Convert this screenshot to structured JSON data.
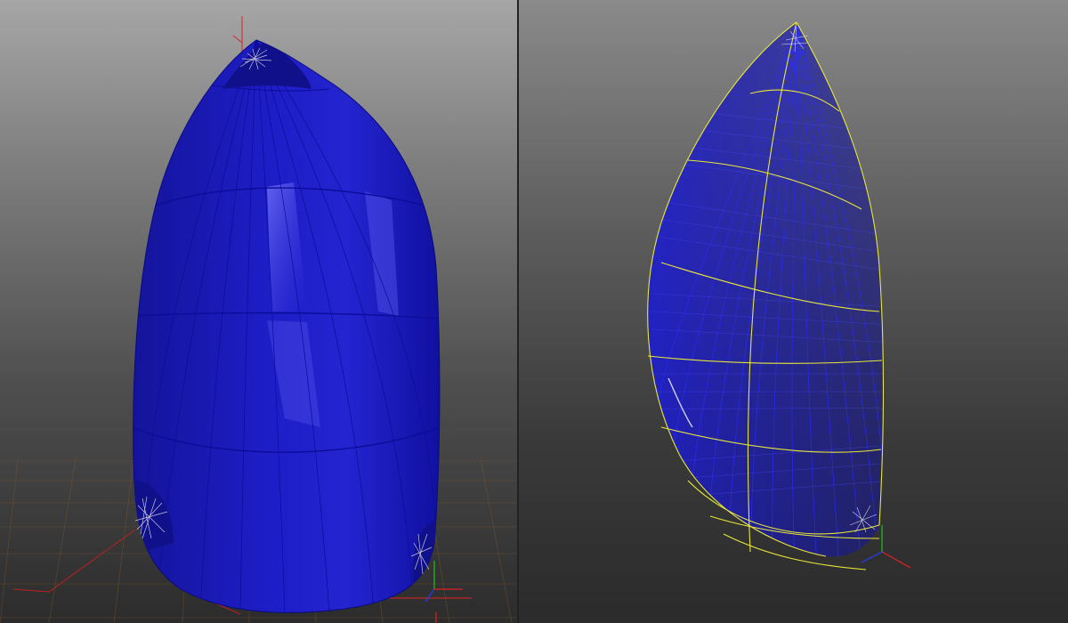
{
  "viewports": [
    {
      "id": "left",
      "render_mode": "shaded",
      "grid": true
    },
    {
      "id": "right",
      "render_mode": "wireframe",
      "grid": false
    }
  ],
  "colors": {
    "sail_fill": "#1a1ab8",
    "sail_fill_dark": "#10108a",
    "panel_line": "#0c0c9a",
    "wire_line": "#2a2aff",
    "seam_line": "#e8e83a",
    "grid_line": "#8a5a2a",
    "axis_x": "#e02020",
    "axis_y": "#20c020",
    "axis_z": "#2040ff",
    "patch_line": "#d8d8e8"
  }
}
